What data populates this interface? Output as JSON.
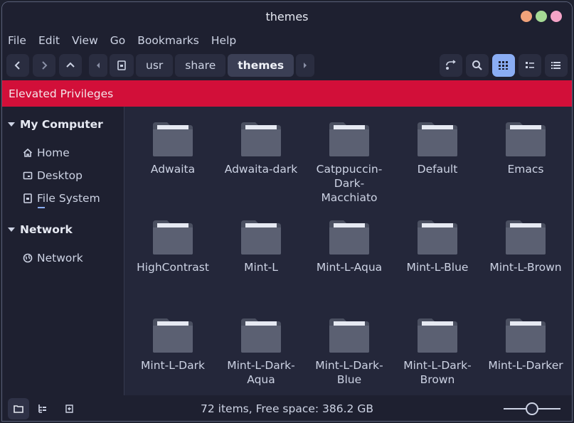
{
  "window": {
    "title": "themes"
  },
  "colors": {
    "close": "#f0a27a",
    "minimize": "#a6da95",
    "maximize": "#f5a3c7",
    "accent": "#8aadf4",
    "elevated": "#d20f39"
  },
  "menu": [
    "File",
    "Edit",
    "View",
    "Go",
    "Bookmarks",
    "Help"
  ],
  "toolbar": {
    "back_icon": "chevron-left-icon",
    "forward_icon": "chevron-right-icon",
    "up_icon": "chevron-up-icon",
    "breadcrumbs": [
      "usr",
      "share",
      "themes"
    ],
    "active_crumb": "themes"
  },
  "privilege_bar": {
    "text": "Elevated Privileges"
  },
  "sidebar": {
    "sections": [
      {
        "label": "My Computer",
        "items": [
          {
            "label": "Home",
            "icon": "home-icon"
          },
          {
            "label": "Desktop",
            "icon": "desktop-icon"
          },
          {
            "label": "File System",
            "icon": "drive-icon"
          }
        ]
      },
      {
        "label": "Network",
        "items": [
          {
            "label": "Network",
            "icon": "network-icon"
          }
        ]
      }
    ]
  },
  "files": [
    "Adwaita",
    "Adwaita-dark",
    "Catppuccin-Dark-Macchiato",
    "Default",
    "Emacs",
    "HighContrast",
    "Mint-L",
    "Mint-L-Aqua",
    "Mint-L-Blue",
    "Mint-L-Brown",
    "Mint-L-Dark",
    "Mint-L-Dark-Aqua",
    "Mint-L-Dark-Blue",
    "Mint-L-Dark-Brown",
    "Mint-L-Darker"
  ],
  "status": {
    "text": "72 items, Free space: 386.2 GB",
    "zoom": 0.5
  }
}
